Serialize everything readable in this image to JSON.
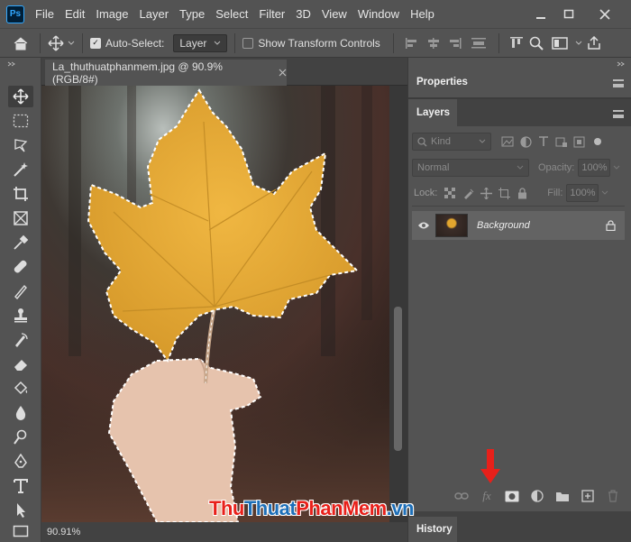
{
  "menubar": {
    "logo": "Ps",
    "items": [
      "File",
      "Edit",
      "Image",
      "Layer",
      "Type",
      "Select",
      "Filter",
      "3D",
      "View",
      "Window",
      "Help"
    ]
  },
  "options": {
    "auto_select_label": "Auto-Select:",
    "auto_select_checked": true,
    "auto_select_target": "Layer",
    "show_transform_label": "Show Transform Controls",
    "show_transform_checked": false
  },
  "document": {
    "tab_title": "La_thuthuatphanmem.jpg @ 90.9% (RGB/8#)",
    "zoom": "90.91%"
  },
  "panels": {
    "properties_tab": "Properties",
    "layers_tab": "Layers",
    "kind_label": "Kind",
    "blend_mode": "Normal",
    "opacity_label": "Opacity:",
    "opacity_value": "100%",
    "lock_label": "Lock:",
    "fill_label": "Fill:",
    "fill_value": "100%",
    "layer_name": "Background",
    "history_tab": "History"
  },
  "watermark": {
    "part1": "Thu",
    "part2": "Thuat",
    "part3": "PhanMem",
    "part4": ".vn",
    "color_red": "#e8201a",
    "color_blue": "#1d6fb8"
  },
  "colors": {
    "ui_bg": "#535353",
    "canvas_bg": "#282828",
    "leaf": "#e3a62e",
    "arrow": "#e8201a"
  }
}
